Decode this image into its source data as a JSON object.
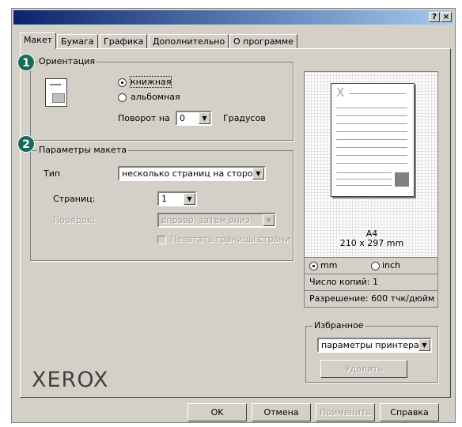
{
  "title_buttons": {
    "help": "?",
    "close": "×"
  },
  "tabs": [
    "Макет",
    "Бумага",
    "Графика",
    "Дополнительно",
    "О программе"
  ],
  "orientation": {
    "badge": "1",
    "label": "Ориентация",
    "portrait": "книжная",
    "landscape": "альбомная",
    "rotate_label": "Поворот на",
    "rotate_value": "0",
    "degrees_label": "Градусов"
  },
  "layout": {
    "badge": "2",
    "label": "Параметры макета",
    "type_label": "Тип",
    "type_value": "несколько страниц на стороне",
    "pages_label": "Страниц:",
    "pages_value": "1",
    "order_label": "Порядок:",
    "order_value": "вправо, затем вниз",
    "borders_label": "Печатать границы страниц"
  },
  "preview": {
    "page_mark": "X",
    "paper": "A4",
    "size": "210 x 297 mm",
    "unit_mm": "mm",
    "unit_inch": "inch",
    "copies": "Число копий: 1",
    "resolution": "Разрешение: 600 тчк/дюйм"
  },
  "favorites": {
    "label": "Избранное",
    "value": "параметры принтера",
    "delete": "Удалить"
  },
  "logo": "XEROX",
  "buttons": {
    "ok": "OK",
    "cancel": "Отмена",
    "apply": "Применить",
    "help": "Справка"
  }
}
